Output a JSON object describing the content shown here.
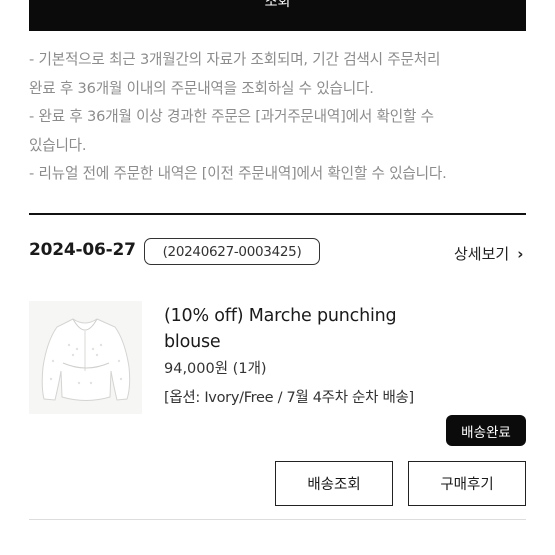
{
  "search_button": {
    "label": "조회"
  },
  "notice": [
    "- 기본적으로 최근 3개월간의 자료가 조회되며, 기간 검색시 주문처리",
    "완료 후 36개월 이내의 주문내역을 조회하실 수 있습니다.",
    "- 완료 후 36개월 이상 경과한 주문은 [과거주문내역]에서 확인할 수",
    "있습니다.",
    "- 리뉴얼 전에 주문한 내역은 [이전 주문내역]에서 확인할 수 있습니다."
  ],
  "order": {
    "date": "2024-06-27",
    "number": "(20240627-0003425)",
    "detail_label": "상세보기",
    "detail_chevron": "›",
    "product": {
      "name": "(10% off) Marche punching blouse",
      "price": "94,000원 (1개)",
      "option": "[옵션: Ivory/Free / 7월 4주차 순차 배송]",
      "thumbnail_icon": "blouse-image"
    },
    "status": "배송완료",
    "track_label": "배송조회",
    "review_label": "구매후기"
  }
}
